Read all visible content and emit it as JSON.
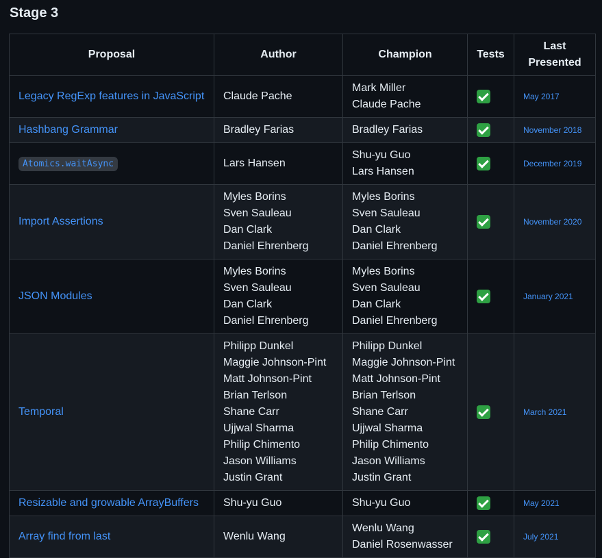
{
  "heading": "Stage 3",
  "columns": {
    "proposal": "Proposal",
    "author": "Author",
    "champion": "Champion",
    "tests": "Tests",
    "last_presented": "Last Presented"
  },
  "check_icon": "check-mark-button-icon",
  "rows": [
    {
      "proposal": "Legacy RegExp features in JavaScript",
      "code": false,
      "authors": [
        "Claude Pache"
      ],
      "champions": [
        "Mark Miller",
        "Claude Pache"
      ],
      "tests": true,
      "last_presented": "May 2017"
    },
    {
      "proposal": "Hashbang Grammar",
      "code": false,
      "authors": [
        "Bradley Farias"
      ],
      "champions": [
        "Bradley Farias"
      ],
      "tests": true,
      "last_presented": "November 2018"
    },
    {
      "proposal": "Atomics.waitAsync",
      "code": true,
      "authors": [
        "Lars Hansen"
      ],
      "champions": [
        "Shu-yu Guo",
        "Lars Hansen"
      ],
      "tests": true,
      "last_presented": "December 2019"
    },
    {
      "proposal": "Import Assertions",
      "code": false,
      "authors": [
        "Myles Borins",
        "Sven Sauleau",
        "Dan Clark",
        "Daniel Ehrenberg"
      ],
      "champions": [
        "Myles Borins",
        "Sven Sauleau",
        "Dan Clark",
        "Daniel Ehrenberg"
      ],
      "tests": true,
      "last_presented": "November 2020"
    },
    {
      "proposal": "JSON Modules",
      "code": false,
      "authors": [
        "Myles Borins",
        "Sven Sauleau",
        "Dan Clark",
        "Daniel Ehrenberg"
      ],
      "champions": [
        "Myles Borins",
        "Sven Sauleau",
        "Dan Clark",
        "Daniel Ehrenberg"
      ],
      "tests": true,
      "last_presented": "January 2021"
    },
    {
      "proposal": "Temporal",
      "code": false,
      "authors": [
        "Philipp Dunkel",
        "Maggie Johnson-Pint",
        "Matt Johnson-Pint",
        "Brian Terlson",
        "Shane Carr",
        "Ujjwal Sharma",
        "Philip Chimento",
        "Jason Williams",
        "Justin Grant"
      ],
      "champions": [
        "Philipp Dunkel",
        "Maggie Johnson-Pint",
        "Matt Johnson-Pint",
        "Brian Terlson",
        "Shane Carr",
        "Ujjwal Sharma",
        "Philip Chimento",
        "Jason Williams",
        "Justin Grant"
      ],
      "tests": true,
      "last_presented": "March 2021"
    },
    {
      "proposal": "Resizable and growable ArrayBuffers",
      "code": false,
      "authors": [
        "Shu-yu Guo"
      ],
      "champions": [
        "Shu-yu Guo"
      ],
      "tests": true,
      "last_presented": "May 2021"
    },
    {
      "proposal": "Array find from last",
      "code": false,
      "authors": [
        "Wenlu Wang"
      ],
      "champions": [
        "Wenlu Wang",
        "Daniel Rosenwasser"
      ],
      "tests": true,
      "last_presented": "July 2021"
    }
  ]
}
